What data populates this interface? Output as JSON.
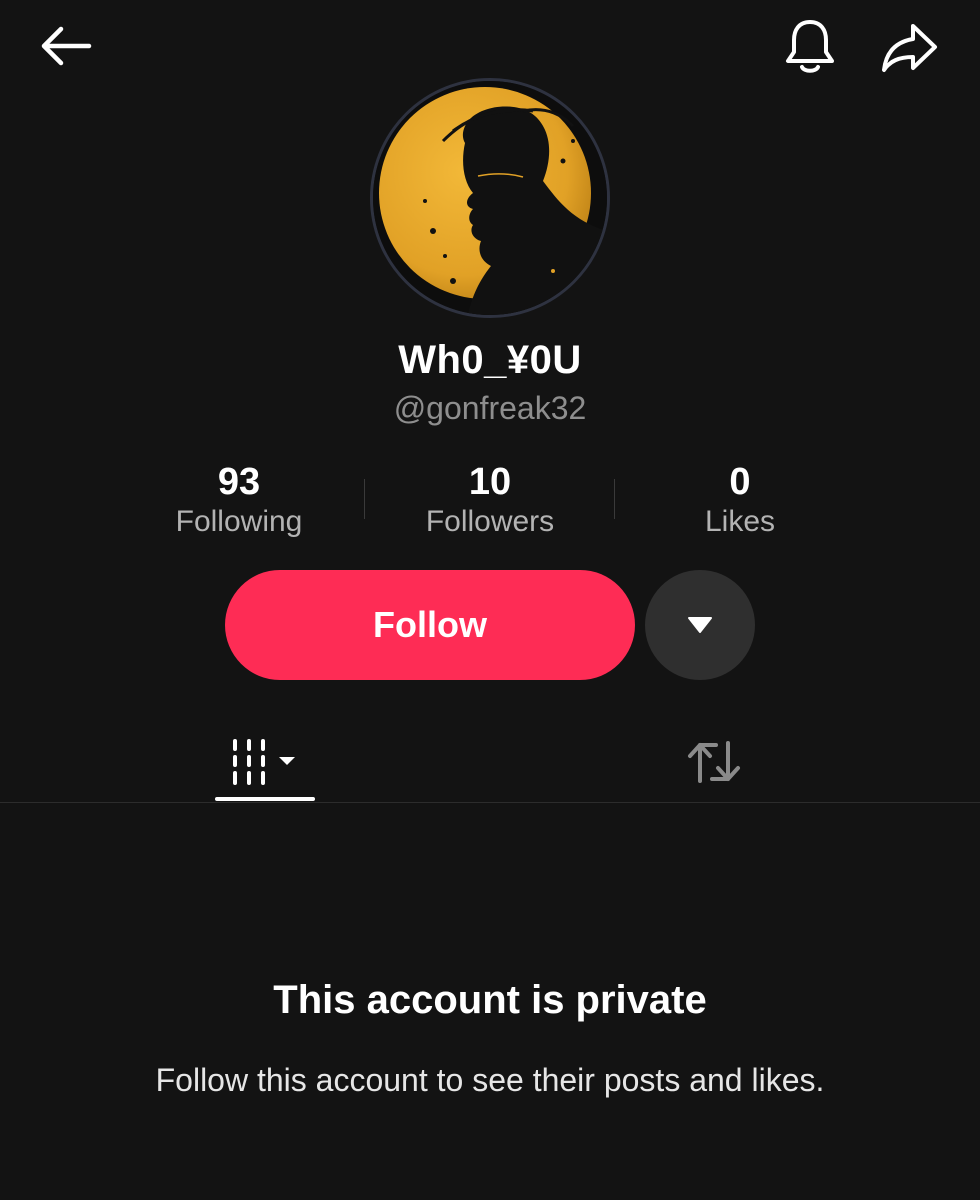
{
  "header": {
    "back_icon": "arrow-left-icon",
    "notification_icon": "bell-icon",
    "share_icon": "share-arrow-icon"
  },
  "profile": {
    "display_name": "Wh0_¥0U",
    "username": "@gonfreak32",
    "avatar": "silhouette-on-gold-circle"
  },
  "stats": [
    {
      "value": "93",
      "label": "Following"
    },
    {
      "value": "10",
      "label": "Followers"
    },
    {
      "value": "0",
      "label": "Likes"
    }
  ],
  "actions": {
    "follow_label": "Follow",
    "more_icon": "caret-down-icon"
  },
  "tabs": [
    {
      "icon": "videos-grid-icon",
      "active": true
    },
    {
      "icon": "repost-icon",
      "active": false
    }
  ],
  "private_notice": {
    "title": "This account is private",
    "message": "Follow this account to see their posts and likes."
  },
  "colors": {
    "background": "#131313",
    "accent": "#fe2c55",
    "secondary_button": "#2f2f2f",
    "muted_text": "#8e8e8e",
    "avatar_gold": "#e2a52a"
  }
}
